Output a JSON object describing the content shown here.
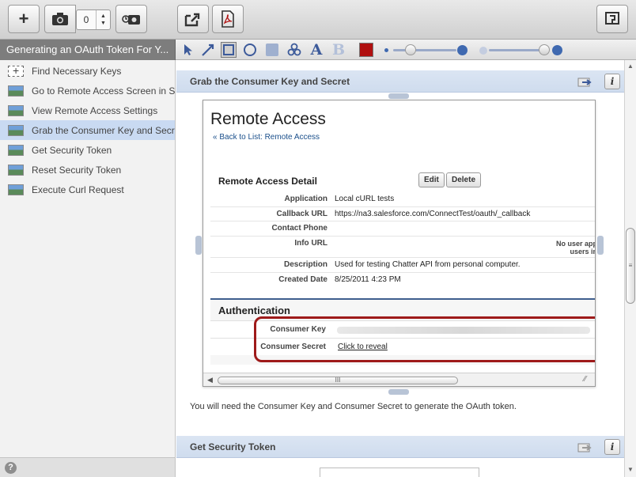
{
  "toolbar": {
    "add_label": "+",
    "counter_value": "0"
  },
  "project": {
    "title": "Generating an OAuth Token For Y..."
  },
  "sidebar": {
    "items": [
      {
        "label": "Find Necessary Keys"
      },
      {
        "label": "Go to Remote Access Screen in S..."
      },
      {
        "label": "View Remote Access Settings"
      },
      {
        "label": "Grab the Consumer Key and Secret"
      },
      {
        "label": "Get Security Token"
      },
      {
        "label": "Reset Security Token"
      },
      {
        "label": "Execute Curl Request"
      }
    ],
    "help_label": "?"
  },
  "drawtools": {
    "text_tool": "A",
    "bold_tool": "B",
    "stroke_color": "#b01010"
  },
  "steps": [
    {
      "title": "Grab the Consumer Key and Secret"
    },
    {
      "title": "Get Security Token"
    }
  ],
  "info_label": "i",
  "screenshot": {
    "title": "Remote Access",
    "back_link": "« Back to List: Remote Access",
    "detail_heading": "Remote Access Detail",
    "edit_label": "Edit",
    "delete_label": "Delete",
    "rows": [
      {
        "label": "Application",
        "value": "Local cURL tests"
      },
      {
        "label": "Callback URL",
        "value": "https://na3.salesforce.com/ConnectTest/oauth/_callback"
      },
      {
        "label": "Contact Phone",
        "value": ""
      },
      {
        "label": "Info URL",
        "value": ""
      },
      {
        "label": "Description",
        "value": "Used for testing Chatter API from personal computer."
      },
      {
        "label": "Created Date",
        "value": "8/25/2011 4:23 PM"
      }
    ],
    "no_user_line1": "No user app",
    "no_user_line2": "users in",
    "auth_heading": "Authentication",
    "consumer_key_label": "Consumer Key",
    "consumer_secret_label": "Consumer Secret",
    "reveal_link": "Click to reveal",
    "scroll_grip": "III"
  },
  "caption": "You will need the Consumer Key and Consumer Secret to generate the OAuth token."
}
